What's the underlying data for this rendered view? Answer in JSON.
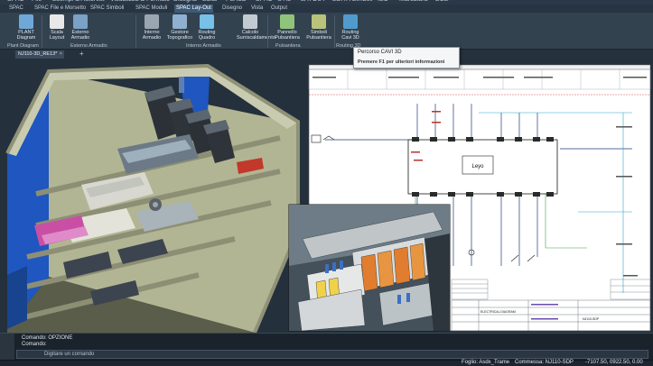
{
  "menu": [
    "SPAC",
    "File",
    "Esempi & Autorest",
    "Visualizza & Formato",
    "Disegna",
    "Edita",
    "PLASD",
    "SPAC",
    "UTIL",
    "LAYOUT",
    "EDITA Simboli",
    "IEC",
    "Marcatura",
    "BCE"
  ],
  "ribbon_tabs": [
    "SPAC",
    "SPAC File e Morsetto",
    "SPAC Simboli",
    "SPAC Moduli",
    "SPAC Lay-Out",
    "Disegno",
    "Vista",
    "Output"
  ],
  "active_tab_index": 4,
  "ribbon": {
    "buttons": [
      {
        "label1": "PLANT",
        "label2": "Diagram",
        "color": "#6fa8d8"
      },
      {
        "label1": "Scala",
        "label2": "Layout",
        "color": "#e8e8e8"
      },
      {
        "label1": "Esterno",
        "label2": "Armadio",
        "color": "#7aa1c6"
      },
      {
        "label1": "Interno",
        "label2": "Armadio",
        "color": "#9aa7b3"
      },
      {
        "label1": "Gestore",
        "label2": "Topografico",
        "color": "#8fb0cf"
      },
      {
        "label1": "Routing",
        "label2": "Quadro",
        "color": "#77c0e6"
      },
      {
        "label1": "Calcolo",
        "label2": "Surriscaldamento",
        "color": "#c3cbd2"
      },
      {
        "label1": "Pannello",
        "label2": "Pulsantiera",
        "color": "#8fc47a"
      },
      {
        "label1": "Simboli",
        "label2": "Pulsantiera",
        "color": "#b9c37a"
      },
      {
        "label1": "Routing",
        "label2": "Cavi 3D",
        "color": "#4f9ccc"
      }
    ],
    "groups": [
      "Plant Diagram",
      "Esterno Armadio",
      "Interno Armadio",
      "Pulsantiera",
      "Routing 3D"
    ]
  },
  "tooltip": {
    "title": "Percorso CAVI 3D",
    "hint": "Premere F1 per ulteriori informazioni"
  },
  "document_tabs": [
    {
      "label": "NJ110-3D_RE13*",
      "close": "×"
    }
  ],
  "add_tab": "+",
  "schematic": {
    "center_label": "Leyo",
    "title_block": {
      "company": "ELECTRICAL DIAGRAM",
      "sheet": "NJ110-SDP"
    }
  },
  "command": {
    "history": [
      "Comando: OPZIONE",
      "Comando:"
    ],
    "placeholder": "Digitare un comando"
  },
  "status": {
    "sheet": "Foglio: Asdx_Trame",
    "order": "Commessa: NJ110-SDP",
    "coords": "-7107.50, 0922.50, 0.00"
  },
  "colors": {
    "accent": "#3d5a78",
    "cabinet_body": "#b7ba98",
    "cabinet_blue": "#1f56c0",
    "schematic_bg": "#ffffff",
    "wire": "#1f3d7a"
  }
}
